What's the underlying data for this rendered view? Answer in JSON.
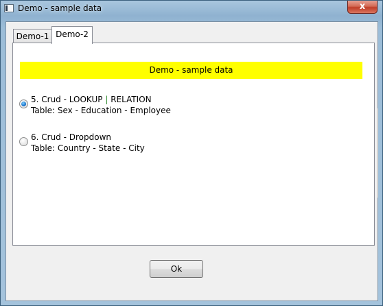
{
  "window": {
    "title": "Demo - sample data",
    "close_glyph": "x"
  },
  "tabs": [
    {
      "label": "Demo-1",
      "active": false
    },
    {
      "label": "Demo-2",
      "active": true
    }
  ],
  "panel": {
    "banner_text": "Demo - sample data",
    "banner_color": "#ffff00",
    "options": [
      {
        "checked": true,
        "title_prefix": "5. Crud - LOOKUP",
        "title_sep": "|",
        "title_suffix": "RELATION",
        "subtitle": "Table: Sex - Education - Employee"
      },
      {
        "checked": false,
        "title": "6. Crud - Dropdown",
        "subtitle": "Table: Country - State - City"
      }
    ]
  },
  "footer": {
    "ok_label": "Ok"
  }
}
